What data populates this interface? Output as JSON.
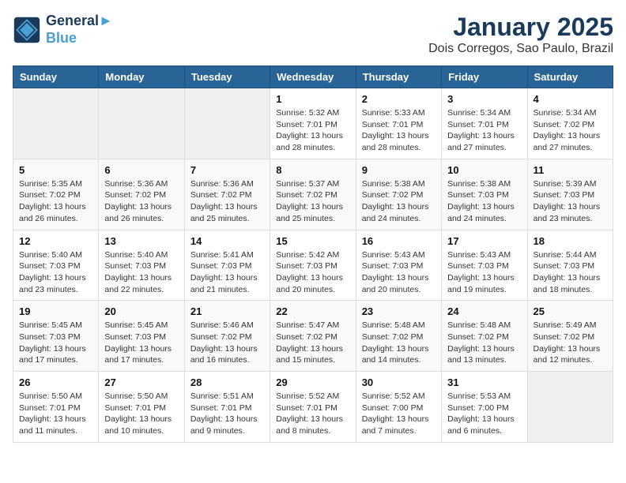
{
  "header": {
    "logo_line1": "General",
    "logo_line2": "Blue",
    "month_title": "January 2025",
    "subtitle": "Dois Corregos, Sao Paulo, Brazil"
  },
  "weekdays": [
    "Sunday",
    "Monday",
    "Tuesday",
    "Wednesday",
    "Thursday",
    "Friday",
    "Saturday"
  ],
  "weeks": [
    [
      {
        "day": "",
        "sunrise": "",
        "sunset": "",
        "daylight": ""
      },
      {
        "day": "",
        "sunrise": "",
        "sunset": "",
        "daylight": ""
      },
      {
        "day": "",
        "sunrise": "",
        "sunset": "",
        "daylight": ""
      },
      {
        "day": "1",
        "sunrise": "5:32 AM",
        "sunset": "7:01 PM",
        "daylight": "13 hours and 28 minutes."
      },
      {
        "day": "2",
        "sunrise": "5:33 AM",
        "sunset": "7:01 PM",
        "daylight": "13 hours and 28 minutes."
      },
      {
        "day": "3",
        "sunrise": "5:34 AM",
        "sunset": "7:01 PM",
        "daylight": "13 hours and 27 minutes."
      },
      {
        "day": "4",
        "sunrise": "5:34 AM",
        "sunset": "7:02 PM",
        "daylight": "13 hours and 27 minutes."
      }
    ],
    [
      {
        "day": "5",
        "sunrise": "5:35 AM",
        "sunset": "7:02 PM",
        "daylight": "13 hours and 26 minutes."
      },
      {
        "day": "6",
        "sunrise": "5:36 AM",
        "sunset": "7:02 PM",
        "daylight": "13 hours and 26 minutes."
      },
      {
        "day": "7",
        "sunrise": "5:36 AM",
        "sunset": "7:02 PM",
        "daylight": "13 hours and 25 minutes."
      },
      {
        "day": "8",
        "sunrise": "5:37 AM",
        "sunset": "7:02 PM",
        "daylight": "13 hours and 25 minutes."
      },
      {
        "day": "9",
        "sunrise": "5:38 AM",
        "sunset": "7:02 PM",
        "daylight": "13 hours and 24 minutes."
      },
      {
        "day": "10",
        "sunrise": "5:38 AM",
        "sunset": "7:03 PM",
        "daylight": "13 hours and 24 minutes."
      },
      {
        "day": "11",
        "sunrise": "5:39 AM",
        "sunset": "7:03 PM",
        "daylight": "13 hours and 23 minutes."
      }
    ],
    [
      {
        "day": "12",
        "sunrise": "5:40 AM",
        "sunset": "7:03 PM",
        "daylight": "13 hours and 23 minutes."
      },
      {
        "day": "13",
        "sunrise": "5:40 AM",
        "sunset": "7:03 PM",
        "daylight": "13 hours and 22 minutes."
      },
      {
        "day": "14",
        "sunrise": "5:41 AM",
        "sunset": "7:03 PM",
        "daylight": "13 hours and 21 minutes."
      },
      {
        "day": "15",
        "sunrise": "5:42 AM",
        "sunset": "7:03 PM",
        "daylight": "13 hours and 20 minutes."
      },
      {
        "day": "16",
        "sunrise": "5:43 AM",
        "sunset": "7:03 PM",
        "daylight": "13 hours and 20 minutes."
      },
      {
        "day": "17",
        "sunrise": "5:43 AM",
        "sunset": "7:03 PM",
        "daylight": "13 hours and 19 minutes."
      },
      {
        "day": "18",
        "sunrise": "5:44 AM",
        "sunset": "7:03 PM",
        "daylight": "13 hours and 18 minutes."
      }
    ],
    [
      {
        "day": "19",
        "sunrise": "5:45 AM",
        "sunset": "7:03 PM",
        "daylight": "13 hours and 17 minutes."
      },
      {
        "day": "20",
        "sunrise": "5:45 AM",
        "sunset": "7:03 PM",
        "daylight": "13 hours and 17 minutes."
      },
      {
        "day": "21",
        "sunrise": "5:46 AM",
        "sunset": "7:02 PM",
        "daylight": "13 hours and 16 minutes."
      },
      {
        "day": "22",
        "sunrise": "5:47 AM",
        "sunset": "7:02 PM",
        "daylight": "13 hours and 15 minutes."
      },
      {
        "day": "23",
        "sunrise": "5:48 AM",
        "sunset": "7:02 PM",
        "daylight": "13 hours and 14 minutes."
      },
      {
        "day": "24",
        "sunrise": "5:48 AM",
        "sunset": "7:02 PM",
        "daylight": "13 hours and 13 minutes."
      },
      {
        "day": "25",
        "sunrise": "5:49 AM",
        "sunset": "7:02 PM",
        "daylight": "13 hours and 12 minutes."
      }
    ],
    [
      {
        "day": "26",
        "sunrise": "5:50 AM",
        "sunset": "7:01 PM",
        "daylight": "13 hours and 11 minutes."
      },
      {
        "day": "27",
        "sunrise": "5:50 AM",
        "sunset": "7:01 PM",
        "daylight": "13 hours and 10 minutes."
      },
      {
        "day": "28",
        "sunrise": "5:51 AM",
        "sunset": "7:01 PM",
        "daylight": "13 hours and 9 minutes."
      },
      {
        "day": "29",
        "sunrise": "5:52 AM",
        "sunset": "7:01 PM",
        "daylight": "13 hours and 8 minutes."
      },
      {
        "day": "30",
        "sunrise": "5:52 AM",
        "sunset": "7:00 PM",
        "daylight": "13 hours and 7 minutes."
      },
      {
        "day": "31",
        "sunrise": "5:53 AM",
        "sunset": "7:00 PM",
        "daylight": "13 hours and 6 minutes."
      },
      {
        "day": "",
        "sunrise": "",
        "sunset": "",
        "daylight": ""
      }
    ]
  ],
  "labels": {
    "sunrise": "Sunrise:",
    "sunset": "Sunset:",
    "daylight": "Daylight:"
  }
}
